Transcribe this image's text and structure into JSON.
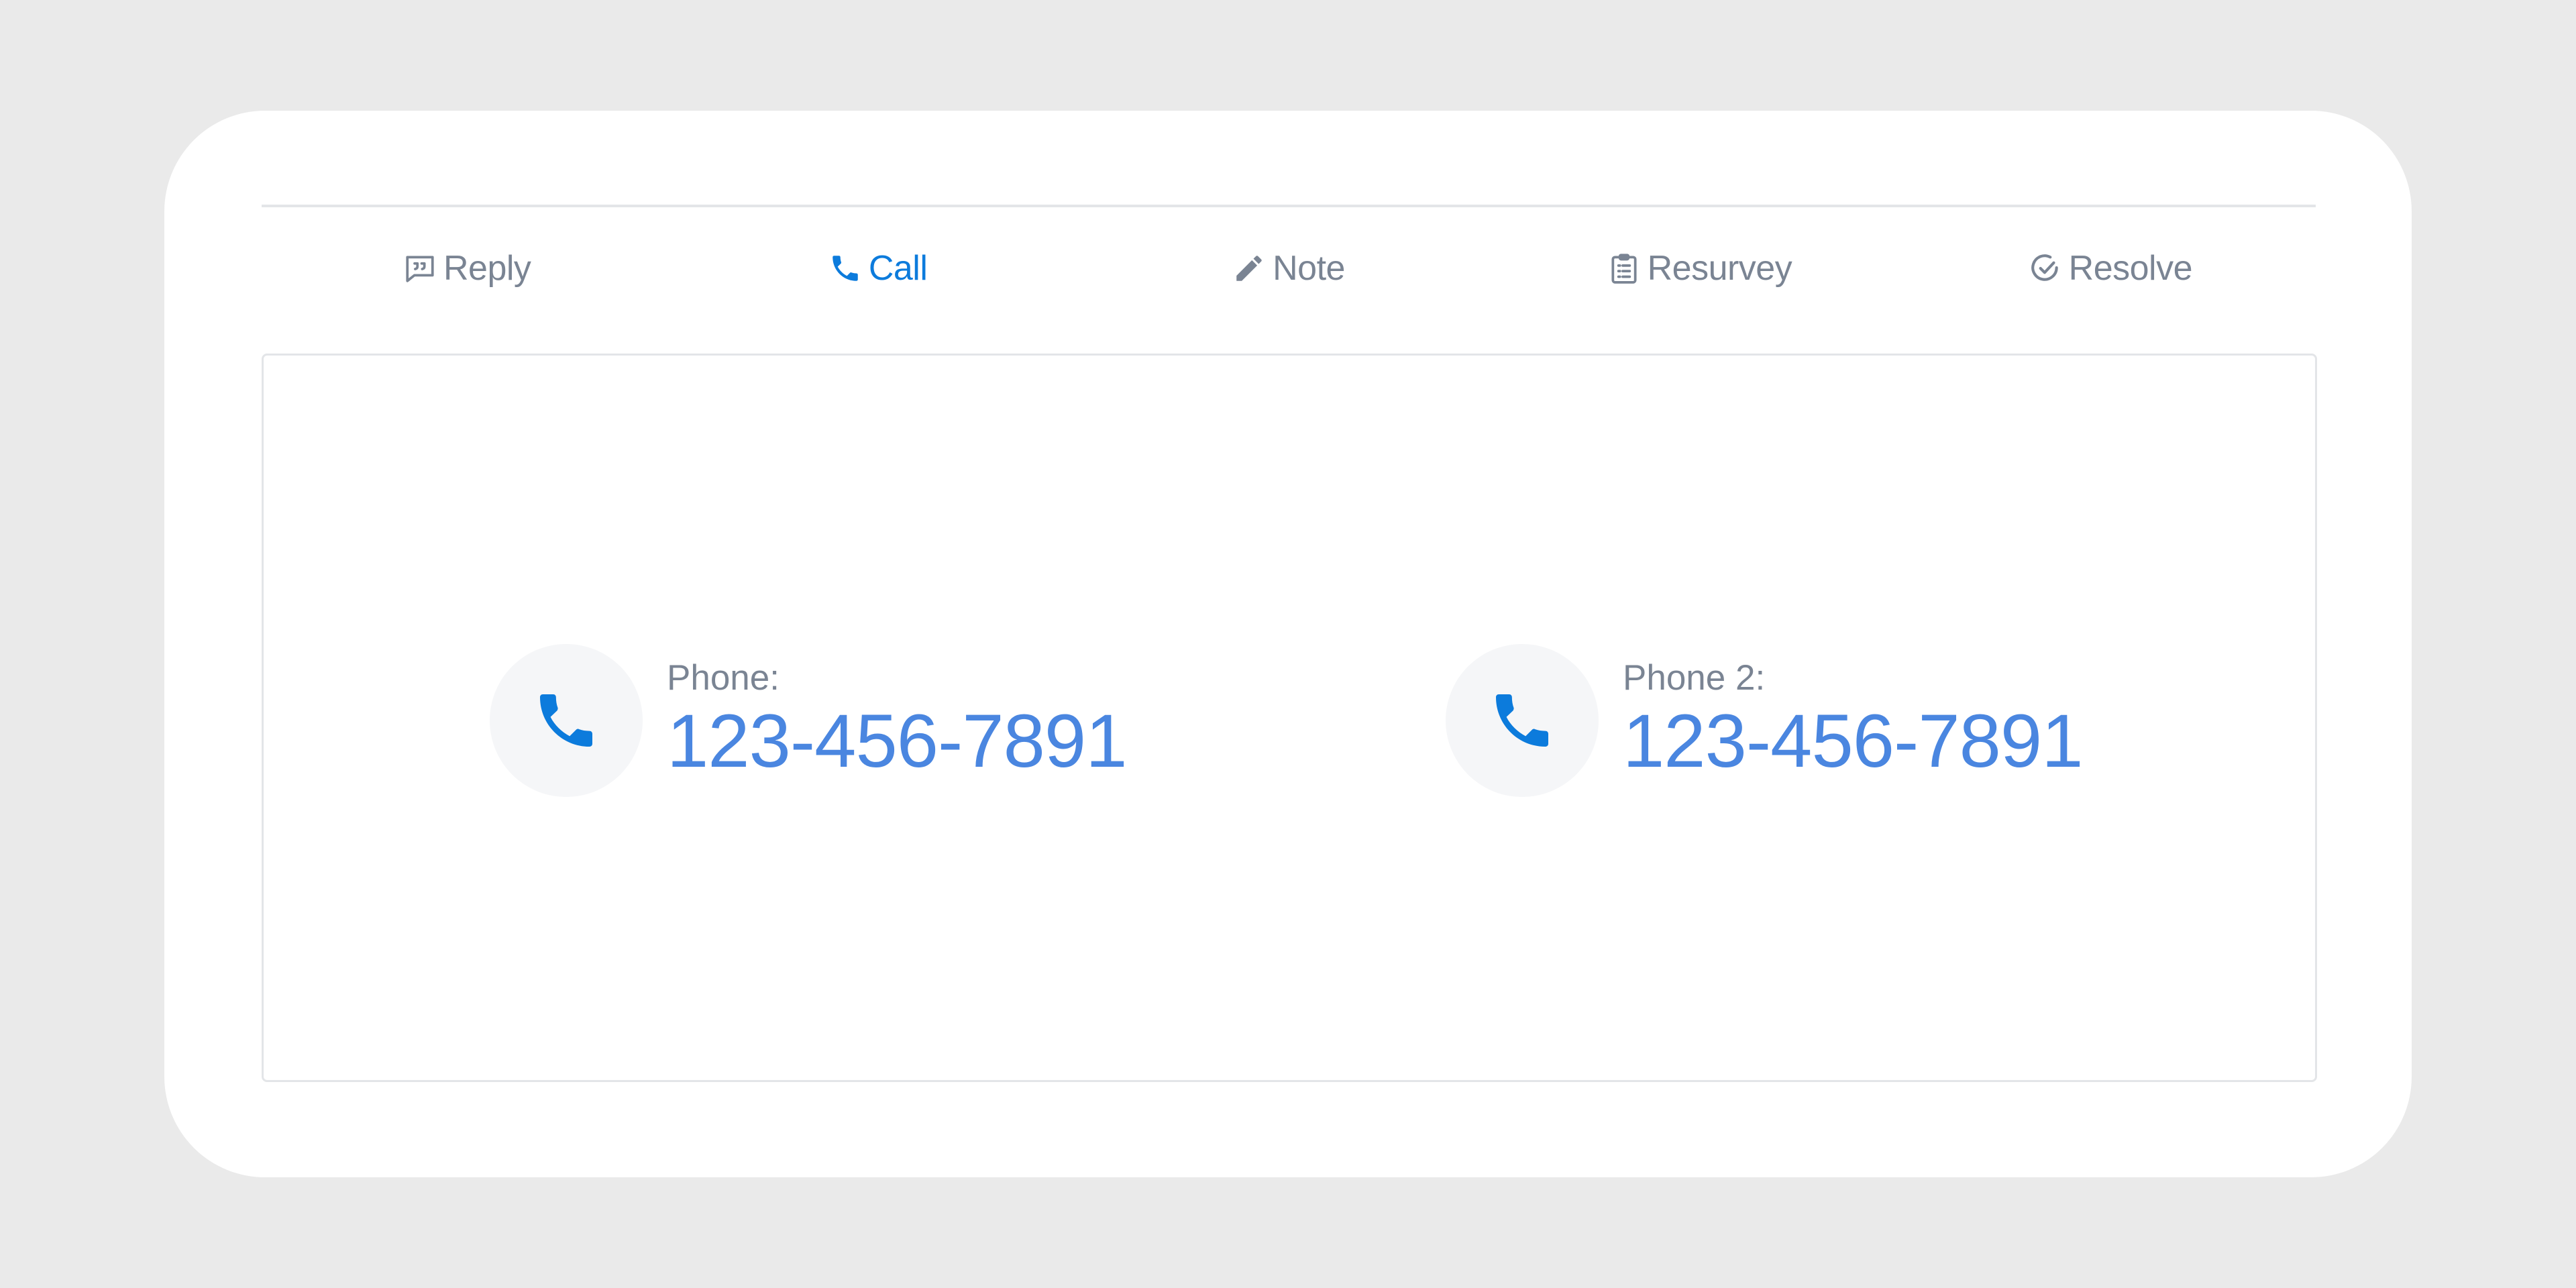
{
  "tabs": [
    {
      "label": "Reply",
      "icon": "comment-quote-icon",
      "active": false
    },
    {
      "label": "Call",
      "icon": "phone-icon",
      "active": true
    },
    {
      "label": "Note",
      "icon": "pencil-icon",
      "active": false
    },
    {
      "label": "Resurvey",
      "icon": "clipboard-list-icon",
      "active": false
    },
    {
      "label": "Resolve",
      "icon": "check-circle-icon",
      "active": false
    }
  ],
  "contacts": [
    {
      "label": "Phone:",
      "number": "123-456-7891",
      "icon": "phone-icon"
    },
    {
      "label": "Phone 2:",
      "number": "123-456-7891",
      "icon": "phone-icon"
    }
  ],
  "colors": {
    "accent": "#0C7BDC",
    "number": "#4A86E0",
    "muted": "#7A8493",
    "background": "#EAEAEA"
  }
}
